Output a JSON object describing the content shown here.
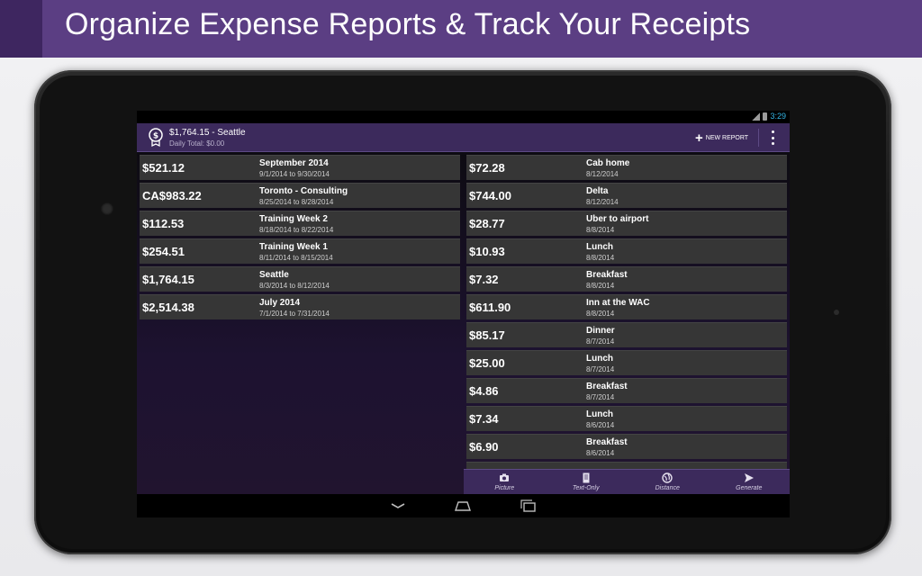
{
  "banner": {
    "title": "Organize Expense Reports & Track Your Receipts"
  },
  "colors": {
    "accent": "#3c2a5c",
    "banner": "#5b3e83",
    "row": "#363636",
    "clock": "#33b5e5"
  },
  "statusbar": {
    "time": "3:29",
    "icons": [
      "signal-icon",
      "battery-icon"
    ]
  },
  "actionbar": {
    "title": "$1,764.15 - Seattle",
    "subtitle": "Daily Total: $0.00",
    "new_report_label": "NEW REPORT",
    "icons": [
      "receipt-dollar-icon",
      "plus-icon",
      "overflow-menu-icon"
    ]
  },
  "reports": [
    {
      "amount": "$521.12",
      "name": "September 2014",
      "dates": "9/1/2014 to 9/30/2014"
    },
    {
      "amount": "CA$983.22",
      "name": "Toronto - Consulting",
      "dates": "8/25/2014 to 8/28/2014"
    },
    {
      "amount": "$112.53",
      "name": "Training Week 2",
      "dates": "8/18/2014 to 8/22/2014"
    },
    {
      "amount": "$254.51",
      "name": "Training Week 1",
      "dates": "8/11/2014 to 8/15/2014"
    },
    {
      "amount": "$1,764.15",
      "name": "Seattle",
      "dates": "8/3/2014 to 8/12/2014"
    },
    {
      "amount": "$2,514.38",
      "name": "July 2014",
      "dates": "7/1/2014 to 7/31/2014"
    }
  ],
  "receipts": [
    {
      "amount": "$72.28",
      "name": "Cab home",
      "date": "8/12/2014"
    },
    {
      "amount": "$744.00",
      "name": "Delta",
      "date": "8/12/2014"
    },
    {
      "amount": "$28.77",
      "name": "Uber to airport",
      "date": "8/8/2014"
    },
    {
      "amount": "$10.93",
      "name": "Lunch",
      "date": "8/8/2014"
    },
    {
      "amount": "$7.32",
      "name": "Breakfast",
      "date": "8/8/2014"
    },
    {
      "amount": "$611.90",
      "name": "Inn at the WAC",
      "date": "8/8/2014"
    },
    {
      "amount": "$85.17",
      "name": "Dinner",
      "date": "8/7/2014"
    },
    {
      "amount": "$25.00",
      "name": "Lunch",
      "date": "8/7/2014"
    },
    {
      "amount": "$4.86",
      "name": "Breakfast",
      "date": "8/7/2014"
    },
    {
      "amount": "$7.34",
      "name": "Lunch",
      "date": "8/6/2014"
    },
    {
      "amount": "$6.90",
      "name": "Breakfast",
      "date": "8/6/2014"
    },
    {
      "amount": "",
      "name": "",
      "date": ""
    }
  ],
  "toolbar": {
    "buttons": [
      {
        "label": "Picture",
        "icon": "camera-icon"
      },
      {
        "label": "Text-Only",
        "icon": "document-icon"
      },
      {
        "label": "Distance",
        "icon": "globe-icon"
      },
      {
        "label": "Generate",
        "icon": "send-icon"
      }
    ]
  },
  "navbar": {
    "icons": [
      "back-icon",
      "home-icon",
      "recent-apps-icon"
    ]
  }
}
